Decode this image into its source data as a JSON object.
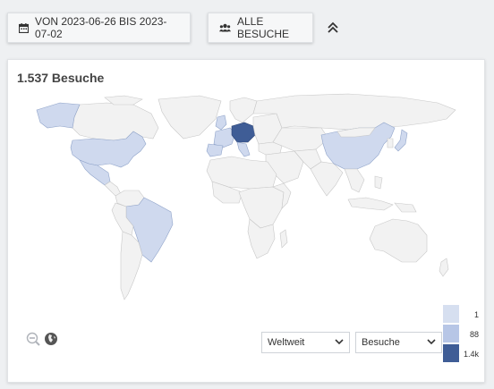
{
  "toolbar": {
    "date_range_label": "VON 2023-06-26 BIS 2023-07-02",
    "date_icon": "calendar-icon",
    "visits_label": "ALLE BESUCHE",
    "visits_icon": "users-icon",
    "collapse_icon": "double-chevron-up-icon"
  },
  "card": {
    "title": "1.537 Besuche"
  },
  "map": {
    "colors": {
      "land": "#f2f2f2",
      "border": "#c8c8c8",
      "low": "#cfd9ee",
      "mid": "#bccbe8",
      "high": "#3f5d96"
    },
    "highlighted_regions": [
      "USA",
      "Mexico",
      "Brazil",
      "Alaska",
      "China",
      "Japan",
      "Central Europe",
      "Germany"
    ],
    "zoom_out_icon": "zoom-out-icon",
    "globe_icon": "globe-icon"
  },
  "controls": {
    "region_select": "Weltweit",
    "metric_select": "Besuche"
  },
  "legend": [
    {
      "label": "1",
      "color": "#d6dff0"
    },
    {
      "label": "88",
      "color": "#b7c6e6"
    },
    {
      "label": "1.4k",
      "color": "#3f5d96"
    }
  ]
}
